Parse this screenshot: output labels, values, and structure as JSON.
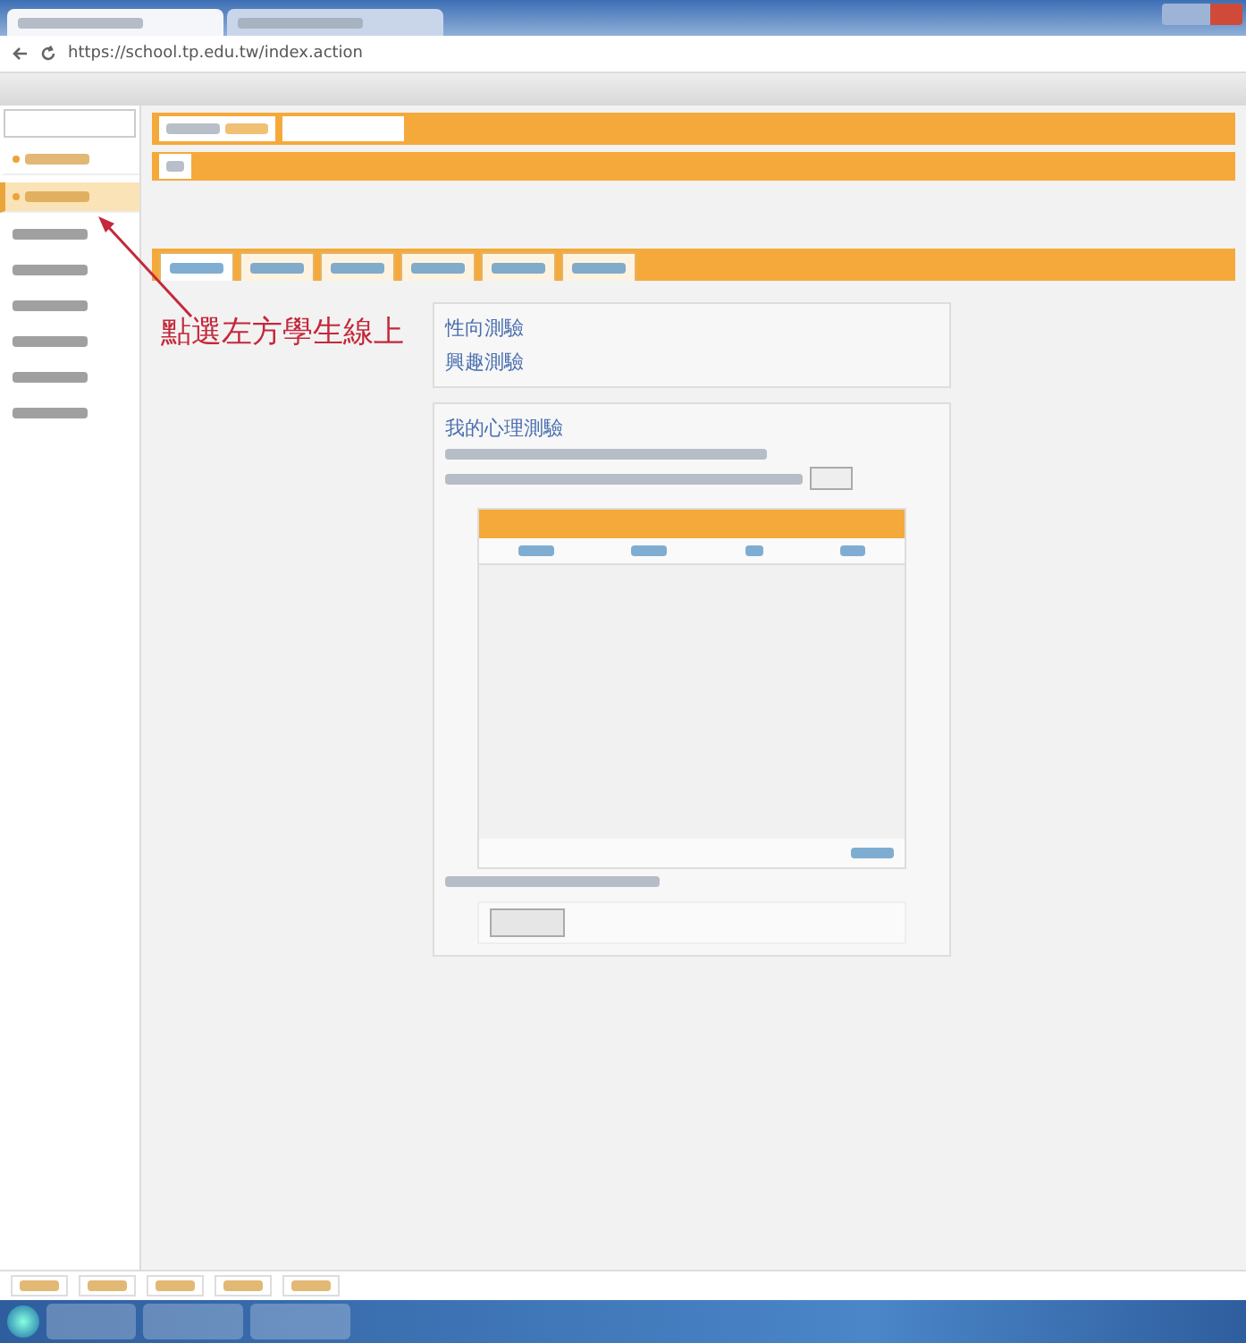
{
  "browser": {
    "tabs": [
      {
        "selected": true
      },
      {
        "selected": false
      }
    ],
    "url": "https://school.tp.edu.tw/index.action"
  },
  "sidebar": {
    "items": [
      {
        "kind": "header",
        "selected": false
      },
      {
        "kind": "header",
        "selected": true
      },
      {
        "kind": "link"
      },
      {
        "kind": "link"
      },
      {
        "kind": "link"
      },
      {
        "kind": "link"
      },
      {
        "kind": "link"
      },
      {
        "kind": "link"
      }
    ]
  },
  "page_tabs": [
    {
      "selected": true
    },
    {
      "selected": false
    },
    {
      "selected": false
    },
    {
      "selected": false
    },
    {
      "selected": false
    },
    {
      "selected": false
    }
  ],
  "annotation": "點選左方學生線上",
  "tests_card": {
    "links": [
      "性向測驗",
      "興趣測驗"
    ]
  },
  "psych_card": {
    "title": "我的心理測驗"
  }
}
